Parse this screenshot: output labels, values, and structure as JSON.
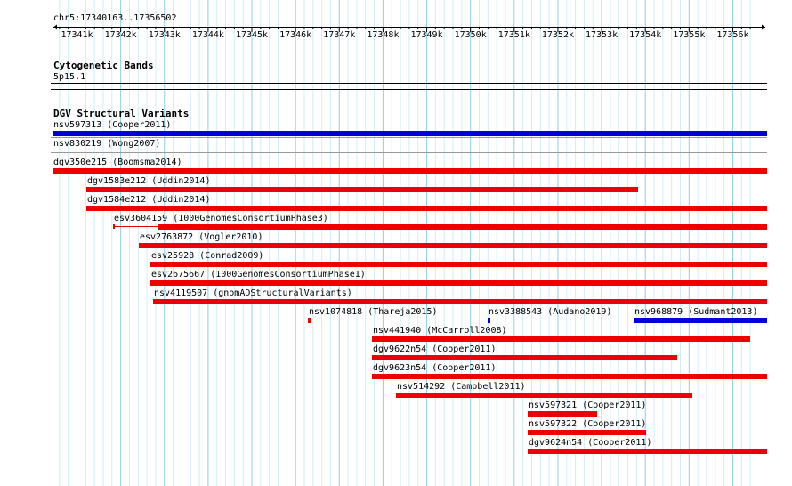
{
  "ruler": {
    "position": "chr5:17340163..17356502",
    "ticks": [
      "17341k",
      "17342k",
      "17343k",
      "17344k",
      "17345k",
      "17346k",
      "17347k",
      "17348k",
      "17349k",
      "17350k",
      "17351k",
      "17352k",
      "17353k",
      "17354k",
      "17355k",
      "17356k"
    ]
  },
  "cytoband": {
    "title": "Cytogenetic Bands",
    "band": "5p15.1"
  },
  "dgv": {
    "title": "DGV Structural Variants",
    "variants": [
      {
        "label": "nsv597313 (Cooper2011)",
        "color": "#0000dd",
        "start": 17340163,
        "end": 17356502,
        "row": 0
      },
      {
        "label": "nsv830219 (Wong2007)",
        "color": "#0000dd",
        "start": 17340163,
        "end": 17356502,
        "row": 1,
        "no_bar": true
      },
      {
        "label": "dgv350e215 (Boomsma2014)",
        "color": "#ee0000",
        "start": 17340163,
        "end": 17356502,
        "row": 2
      },
      {
        "label": "dgv1583e212 (Uddin2014)",
        "color": "#ee0000",
        "start": 17340928,
        "end": 17353553,
        "row": 3
      },
      {
        "label": "dgv1584e212 (Uddin2014)",
        "color": "#ee0000",
        "start": 17340928,
        "end": 17356502,
        "row": 4
      },
      {
        "label": "esv3604159 (1000GenomesConsortiumPhase3)",
        "color": "#ee0000",
        "start": 17341550,
        "end": 17356502,
        "row": 5,
        "thin_start": 17341550,
        "thin_end": 17342560
      },
      {
        "label": "esv2763872 (Vogler2010)",
        "color": "#ee0000",
        "start": 17342130,
        "end": 17356502,
        "row": 6
      },
      {
        "label": "esv25928 (Conrad2009)",
        "color": "#ee0000",
        "start": 17342410,
        "end": 17356502,
        "row": 7
      },
      {
        "label": "esv2675667 (1000GenomesConsortiumPhase1)",
        "color": "#ee0000",
        "start": 17342410,
        "end": 17356502,
        "row": 8
      },
      {
        "label": "nsv4119507 (gnomADStructuralVariants)",
        "color": "#ee0000",
        "start": 17342460,
        "end": 17356502,
        "row": 9
      },
      {
        "label": "nsv1074818 (Thareja2015)",
        "color": "#ee0000",
        "start": 17346010,
        "end": 17346090,
        "row": 10
      },
      {
        "label": "nsv3388543 (Audano2019)",
        "color": "#0000dd",
        "start": 17350105,
        "end": 17350145,
        "row": 10
      },
      {
        "label": "nsv968879 (Sudmant2013)",
        "color": "#0000dd",
        "start": 17353460,
        "end": 17356502,
        "row": 10
      },
      {
        "label": "nsv441940 (McCarroll2008)",
        "color": "#ee0000",
        "start": 17347460,
        "end": 17356120,
        "row": 11
      },
      {
        "label": "dgv9622n54 (Cooper2011)",
        "color": "#ee0000",
        "start": 17347460,
        "end": 17354450,
        "row": 12
      },
      {
        "label": "dgv9623n54 (Cooper2011)",
        "color": "#ee0000",
        "start": 17347460,
        "end": 17356502,
        "row": 13
      },
      {
        "label": "nsv514292 (Campbell2011)",
        "color": "#ee0000",
        "start": 17348010,
        "end": 17354800,
        "row": 14
      },
      {
        "label": "nsv597321 (Cooper2011)",
        "color": "#ee0000",
        "start": 17351030,
        "end": 17352620,
        "row": 15
      },
      {
        "label": "nsv597322 (Cooper2011)",
        "color": "#ee0000",
        "start": 17351030,
        "end": 17353740,
        "row": 16
      },
      {
        "label": "dgv9624n54 (Cooper2011)",
        "color": "#ee0000",
        "start": 17351030,
        "end": 17356502,
        "row": 17
      }
    ]
  }
}
